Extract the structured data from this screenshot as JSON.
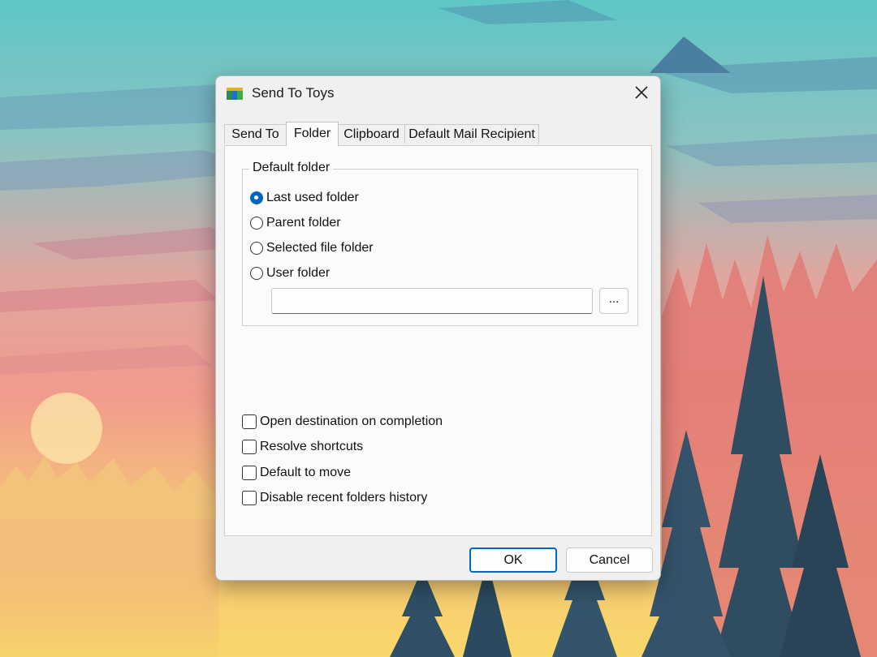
{
  "window": {
    "title": "Send To Toys",
    "icon": "sendtotoys-app-icon",
    "close_icon": "close-icon"
  },
  "tabs": [
    {
      "label": "Send To",
      "active": false
    },
    {
      "label": "Folder",
      "active": true
    },
    {
      "label": "Clipboard",
      "active": false
    },
    {
      "label": "Default Mail Recipient",
      "active": false
    }
  ],
  "default_folder": {
    "legend": "Default folder",
    "options": [
      {
        "label": "Last used folder",
        "checked": true
      },
      {
        "label": "Parent folder",
        "checked": false
      },
      {
        "label": "Selected file folder",
        "checked": false
      },
      {
        "label": "User folder",
        "checked": false
      }
    ],
    "user_folder_value": "",
    "browse_label": "..."
  },
  "options": [
    {
      "label": "Open destination on completion",
      "checked": false
    },
    {
      "label": "Resolve shortcuts",
      "checked": false
    },
    {
      "label": "Default to move",
      "checked": false
    },
    {
      "label": "Disable recent folders history",
      "checked": false
    }
  ],
  "buttons": {
    "ok": "OK",
    "cancel": "Cancel"
  },
  "colors": {
    "accent": "#0067c0"
  }
}
